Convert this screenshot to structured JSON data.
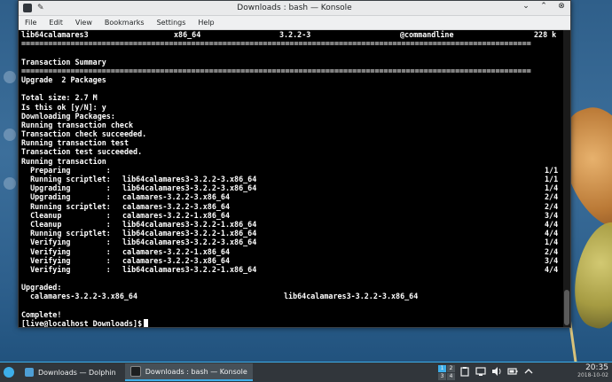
{
  "window": {
    "title": "Downloads : bash — Konsole",
    "controls": {
      "minimize": "⌄",
      "maximize": "⌃",
      "close": "⊗"
    }
  },
  "menu": [
    "File",
    "Edit",
    "View",
    "Bookmarks",
    "Settings",
    "Help"
  ],
  "terminal": {
    "table_row": [
      "lib64calamares3",
      "x86_64",
      "3.2.2-3",
      "@commandline",
      "228 k"
    ],
    "separator": "==================================================================================================================",
    "lines": [
      "",
      "Transaction Summary",
      "==================================================================================================================",
      "Upgrade  2 Packages",
      "",
      "Total size: 2.7 M",
      "Is this ok [y/N]: y",
      "Downloading Packages:",
      "Running transaction check",
      "Transaction check succeeded.",
      "Running transaction test",
      "Transaction test succeeded.",
      "Running transaction"
    ],
    "steps": [
      {
        "action": "  Preparing        :",
        "pkg": "",
        "count": "1/1"
      },
      {
        "action": "  Running scriptlet:",
        "pkg": "lib64calamares3-3.2.2-3.x86_64",
        "count": "1/1"
      },
      {
        "action": "  Upgrading        :",
        "pkg": "lib64calamares3-3.2.2-3.x86_64",
        "count": "1/4"
      },
      {
        "action": "  Upgrading        :",
        "pkg": "calamares-3.2.2-3.x86_64",
        "count": "2/4"
      },
      {
        "action": "  Running scriptlet:",
        "pkg": "calamares-3.2.2-3.x86_64",
        "count": "2/4"
      },
      {
        "action": "  Cleanup          :",
        "pkg": "calamares-3.2.2-1.x86_64",
        "count": "3/4"
      },
      {
        "action": "  Cleanup          :",
        "pkg": "lib64calamares3-3.2.2-1.x86_64",
        "count": "4/4"
      },
      {
        "action": "  Running scriptlet:",
        "pkg": "lib64calamares3-3.2.2-1.x86_64",
        "count": "4/4"
      },
      {
        "action": "  Verifying        :",
        "pkg": "lib64calamares3-3.2.2-3.x86_64",
        "count": "1/4"
      },
      {
        "action": "  Verifying        :",
        "pkg": "calamares-3.2.2-1.x86_64",
        "count": "2/4"
      },
      {
        "action": "  Verifying        :",
        "pkg": "calamares-3.2.2-3.x86_64",
        "count": "3/4"
      },
      {
        "action": "  Verifying        :",
        "pkg": "lib64calamares3-3.2.2-1.x86_64",
        "count": "4/4"
      }
    ],
    "upgraded_header": "Upgraded:",
    "upgraded": [
      "calamares-3.2.2-3.x86_64",
      "lib64calamares3-3.2.2-3.x86_64"
    ],
    "complete": "Complete!",
    "prompt": "[live@localhost Downloads]$"
  },
  "taskbar": {
    "tasks": [
      {
        "label": "Downloads — Dolphin",
        "icon": "folder-icon",
        "active": false
      },
      {
        "label": "Downloads : bash — Konsole",
        "icon": "terminal-icon",
        "active": true
      }
    ],
    "pager": [
      "1",
      "2",
      "3",
      "4"
    ],
    "time": "20:35",
    "date": "2018-10-02"
  },
  "colors": {
    "accent": "#3daee9",
    "panel": "#31363b",
    "terminal_bg": "#000000"
  }
}
